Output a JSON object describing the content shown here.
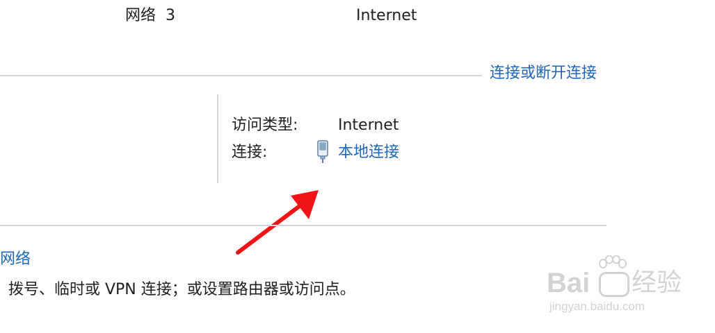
{
  "network": {
    "name": "网络",
    "number": "3",
    "access_header": "Internet"
  },
  "connect_link": "连接或断开连接",
  "details": {
    "access_type_label": "访问类型:",
    "access_type_value": "Internet",
    "connection_label": "连接:",
    "connection_value": "本地连接"
  },
  "setup": {
    "link_fragment": "网络",
    "description": "拨号、临时或 VPN 连接；或设置路由器或访问点。"
  },
  "watermark": {
    "brand_left": "Bai",
    "brand_right": "经验",
    "url": "jingyan.baidu.com"
  },
  "colors": {
    "link": "#1e66b8",
    "arrow": "#f01414",
    "divider": "#d6d6d6"
  }
}
